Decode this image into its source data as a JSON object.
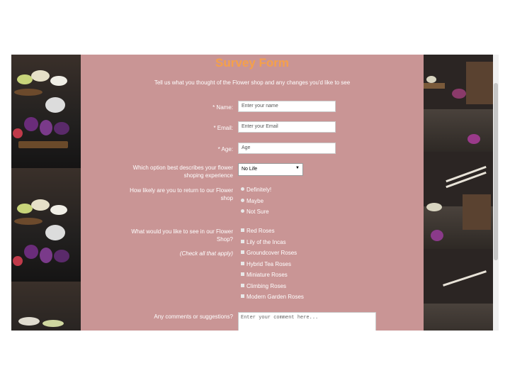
{
  "form": {
    "title": "Survey Form",
    "subtitle": "Tell us what you thought of the Flower shop and any changes you'd like to see",
    "name_label": "* Name:",
    "name_placeholder": "Enter your name",
    "email_label": "* Email:",
    "email_placeholder": "Enter your Email",
    "age_label": "* Age:",
    "age_placeholder": "Age",
    "option_label_line1": "Which option best describes your flower",
    "option_label_line2": "shoping experience",
    "option_selected": "No Life",
    "return_label_line1": "How likely are you to return to our Flower",
    "return_label_line2": "shop",
    "return_options": [
      "Definitely!",
      "Maybe",
      "Not Sure"
    ],
    "see_label_line1": "What would you like to see in our Flower",
    "see_label_line2": "Shop?",
    "check_hint": "(Check all that apply)",
    "see_options": [
      "Red Roses",
      "Lily of the Incas",
      "Groundcover Roses",
      "Hybrid Tea Roses",
      "Miniature Roses",
      "Climbing Roses",
      "Modern Garden Roses"
    ],
    "comments_label": "Any comments or suggestions?",
    "comments_placeholder": "Enter your comment here..."
  },
  "colors": {
    "form_bg": "#c99595",
    "title": "#f5a04a"
  }
}
